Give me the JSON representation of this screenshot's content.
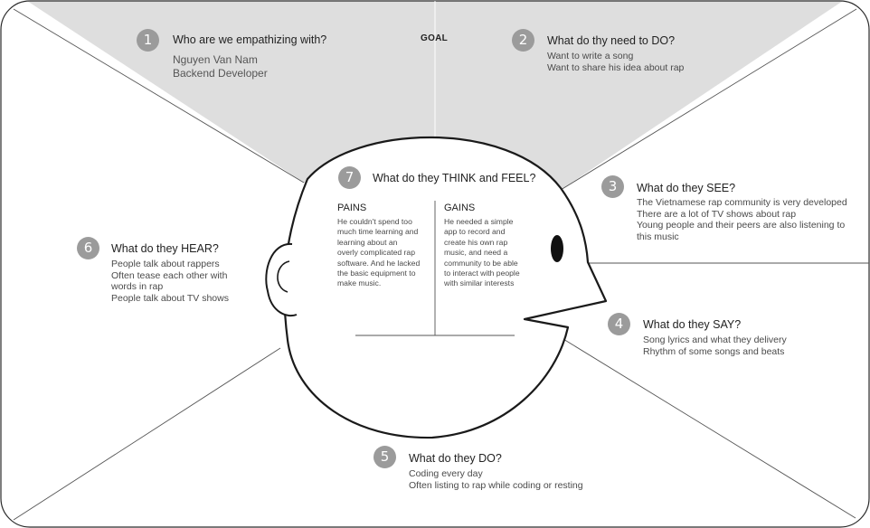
{
  "goal_label": "GOAL",
  "sections": {
    "who": {
      "number": "1",
      "title": "Who are we empathizing with?",
      "lines": [
        "Nguyen Van Nam",
        "Backend Developer"
      ]
    },
    "do_need": {
      "number": "2",
      "title": "What do thy need to DO?",
      "lines": [
        "Want to write a song",
        "Want to share his idea about rap"
      ]
    },
    "see": {
      "number": "3",
      "title": "What do they SEE?",
      "lines": [
        "The Vietnamese rap community is very developed",
        "There are a lot of TV shows about rap",
        "Young people and their peers are also listening to",
        "this music"
      ]
    },
    "say": {
      "number": "4",
      "title": "What do they SAY?",
      "lines": [
        "Song lyrics and what they delivery",
        "Rhythm of some songs and beats"
      ]
    },
    "do": {
      "number": "5",
      "title": "What do they DO?",
      "lines": [
        "Coding every day",
        "Often listing to rap while coding or resting"
      ]
    },
    "hear": {
      "number": "6",
      "title": "What do they HEAR?",
      "lines": [
        "People talk about rappers",
        "Often tease each other with",
        "words in rap",
        "People talk about TV shows"
      ]
    },
    "think_feel": {
      "number": "7",
      "title": "What do they THINK and FEEL?",
      "pains_title": "PAINS",
      "pains_lines": [
        "He couldn't spend too",
        "much time learning and",
        "learning about an",
        "overly complicated rap",
        "software. And he lacked",
        "the basic equipment to",
        "make music."
      ],
      "gains_title": "GAINS",
      "gains_lines": [
        "He needed a simple",
        "app to record and",
        "create his own rap",
        "music, and need a",
        "community to be able",
        "to interact with people",
        "with similar interests"
      ]
    }
  },
  "colors": {
    "goal_fill": "#dedede",
    "number_badge": "#9b9b9b",
    "outline": "#1a1a1a",
    "divider": "#555555"
  }
}
